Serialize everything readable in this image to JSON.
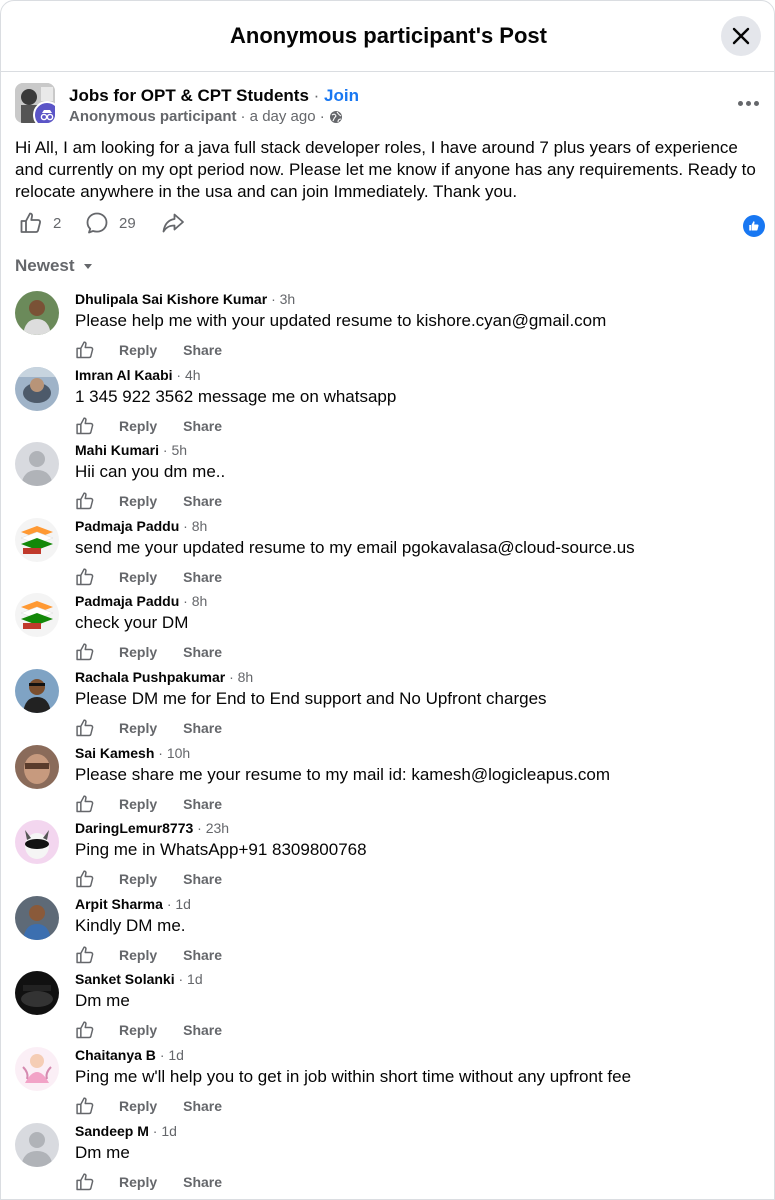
{
  "header": {
    "title": "Anonymous participant's Post"
  },
  "post": {
    "group_name": "Jobs for OPT & CPT Students",
    "dot": "·",
    "join_label": "Join",
    "author": "Anonymous participant",
    "time": "· a day ago ·",
    "body": "Hi All, I am looking for a java full stack developer roles, I have around 7 plus years of experience and currently on my opt period now. Please let me know if anyone has any requirements. Ready to relocate anywhere in the usa and can join Immediately. Thank you.",
    "likes": "2",
    "comments": "29"
  },
  "sort": {
    "label": "Newest"
  },
  "colors": {
    "accent": "#1877f2",
    "secondary_text": "#65676b",
    "divider": "#dadde1"
  },
  "comment_actions": {
    "reply": "Reply",
    "share": "Share"
  },
  "comments": [
    {
      "name": "Dhulipala Sai Kishore Kumar",
      "time": "· 3h",
      "text": "Please help me with your updated resume to kishore.cyan@gmail.com"
    },
    {
      "name": "Imran Al Kaabi",
      "time": "· 4h",
      "text": "1 345 922 3562 message me on whatsapp"
    },
    {
      "name": "Mahi Kumari",
      "time": "· 5h",
      "text": "Hii can you dm me.."
    },
    {
      "name": "Padmaja Paddu",
      "time": "· 8h",
      "text": "send me your updated resume to my email pgokavalasa@cloud-source.us"
    },
    {
      "name": "Padmaja Paddu",
      "time": "· 8h",
      "text": "check your DM"
    },
    {
      "name": "Rachala Pushpakumar",
      "time": "· 8h",
      "text": "Please DM me for End to End support and No Upfront charges"
    },
    {
      "name": "Sai Kamesh",
      "time": "· 10h",
      "text": "Please share me your resume to my mail id: kamesh@logicleapus.com"
    },
    {
      "name": "DaringLemur8773",
      "time": "· 23h",
      "text": "Ping me in WhatsApp+91 8309800768"
    },
    {
      "name": "Arpit Sharma",
      "time": "· 1d",
      "text": "Kindly DM me."
    },
    {
      "name": "Sanket Solanki",
      "time": "· 1d",
      "text": "Dm me"
    },
    {
      "name": "Chaitanya B",
      "time": "· 1d",
      "text": "Ping me w'll help you to get in job within short time without any upfront fee"
    },
    {
      "name": "Sandeep M",
      "time": "· 1d",
      "text": "Dm me"
    }
  ]
}
